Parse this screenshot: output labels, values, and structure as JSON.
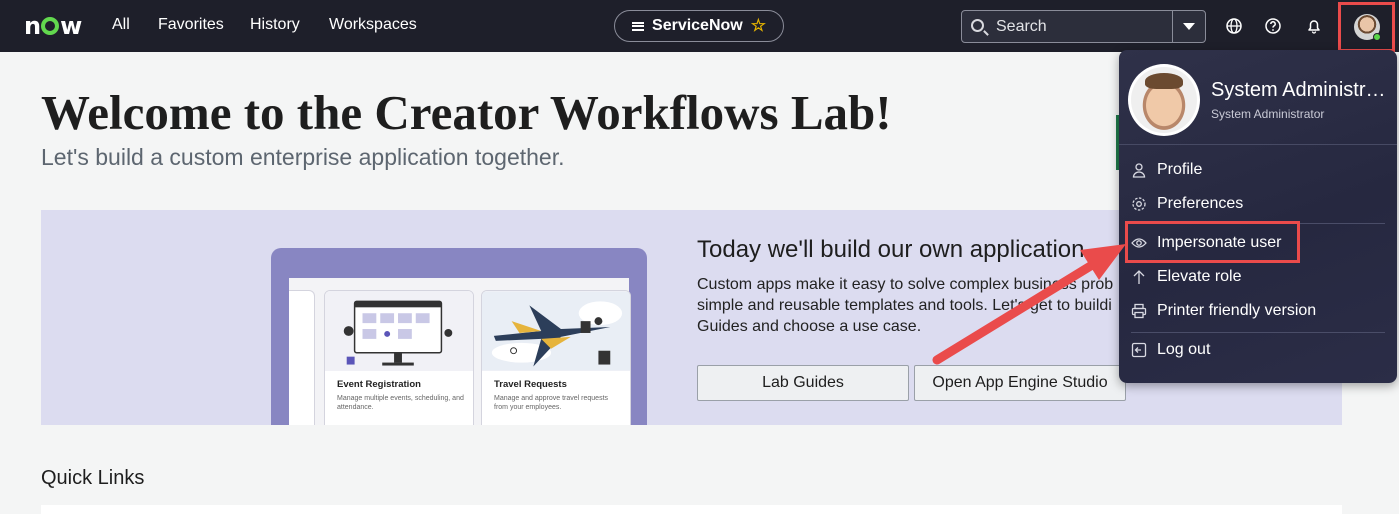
{
  "topbar": {
    "logo": "now",
    "nav": [
      "All",
      "Favorites",
      "History",
      "Workspaces"
    ],
    "context_pill": "ServiceNow",
    "search": {
      "placeholder": "Search"
    }
  },
  "main": {
    "title": "Welcome to the Creator Workflows Lab!",
    "subtitle": "Let's build a custom enterprise application together.",
    "banner": {
      "heading": "Today we'll build our own application",
      "description_lines": [
        "Custom apps make it easy to solve complex business prob",
        "simple and reusable templates and tools. Let's get to buildi",
        "Guides and choose a use case."
      ],
      "cards": [
        {
          "title": "Event Registration",
          "description": "Manage multiple events, scheduling, and attendance."
        },
        {
          "title": "Travel Requests",
          "description": "Manage and approve travel requests from your employees."
        }
      ],
      "buttons": {
        "lab_guides": "Lab Guides",
        "open_studio": "Open App Engine Studio"
      }
    },
    "quick_links": "Quick Links"
  },
  "user_menu": {
    "name": "System Administra...",
    "role": "System Administrator",
    "items": {
      "profile": "Profile",
      "preferences": "Preferences",
      "impersonate": "Impersonate user",
      "elevate": "Elevate role",
      "printer": "Printer friendly version",
      "logout": "Log out"
    }
  },
  "colors": {
    "topbar": "#1e1f2a",
    "accent_green": "#62d84e",
    "annotation_red": "#ea4b4b",
    "menu_bg": "#2a2c44",
    "banner_bg": "#dcdcf0"
  },
  "icons": {
    "nav": [
      "globe-icon",
      "help-icon",
      "bell-icon"
    ],
    "menu": [
      "person-icon",
      "gear-icon",
      "eye-icon",
      "arrow-up-icon",
      "printer-icon",
      "logout-icon"
    ]
  }
}
